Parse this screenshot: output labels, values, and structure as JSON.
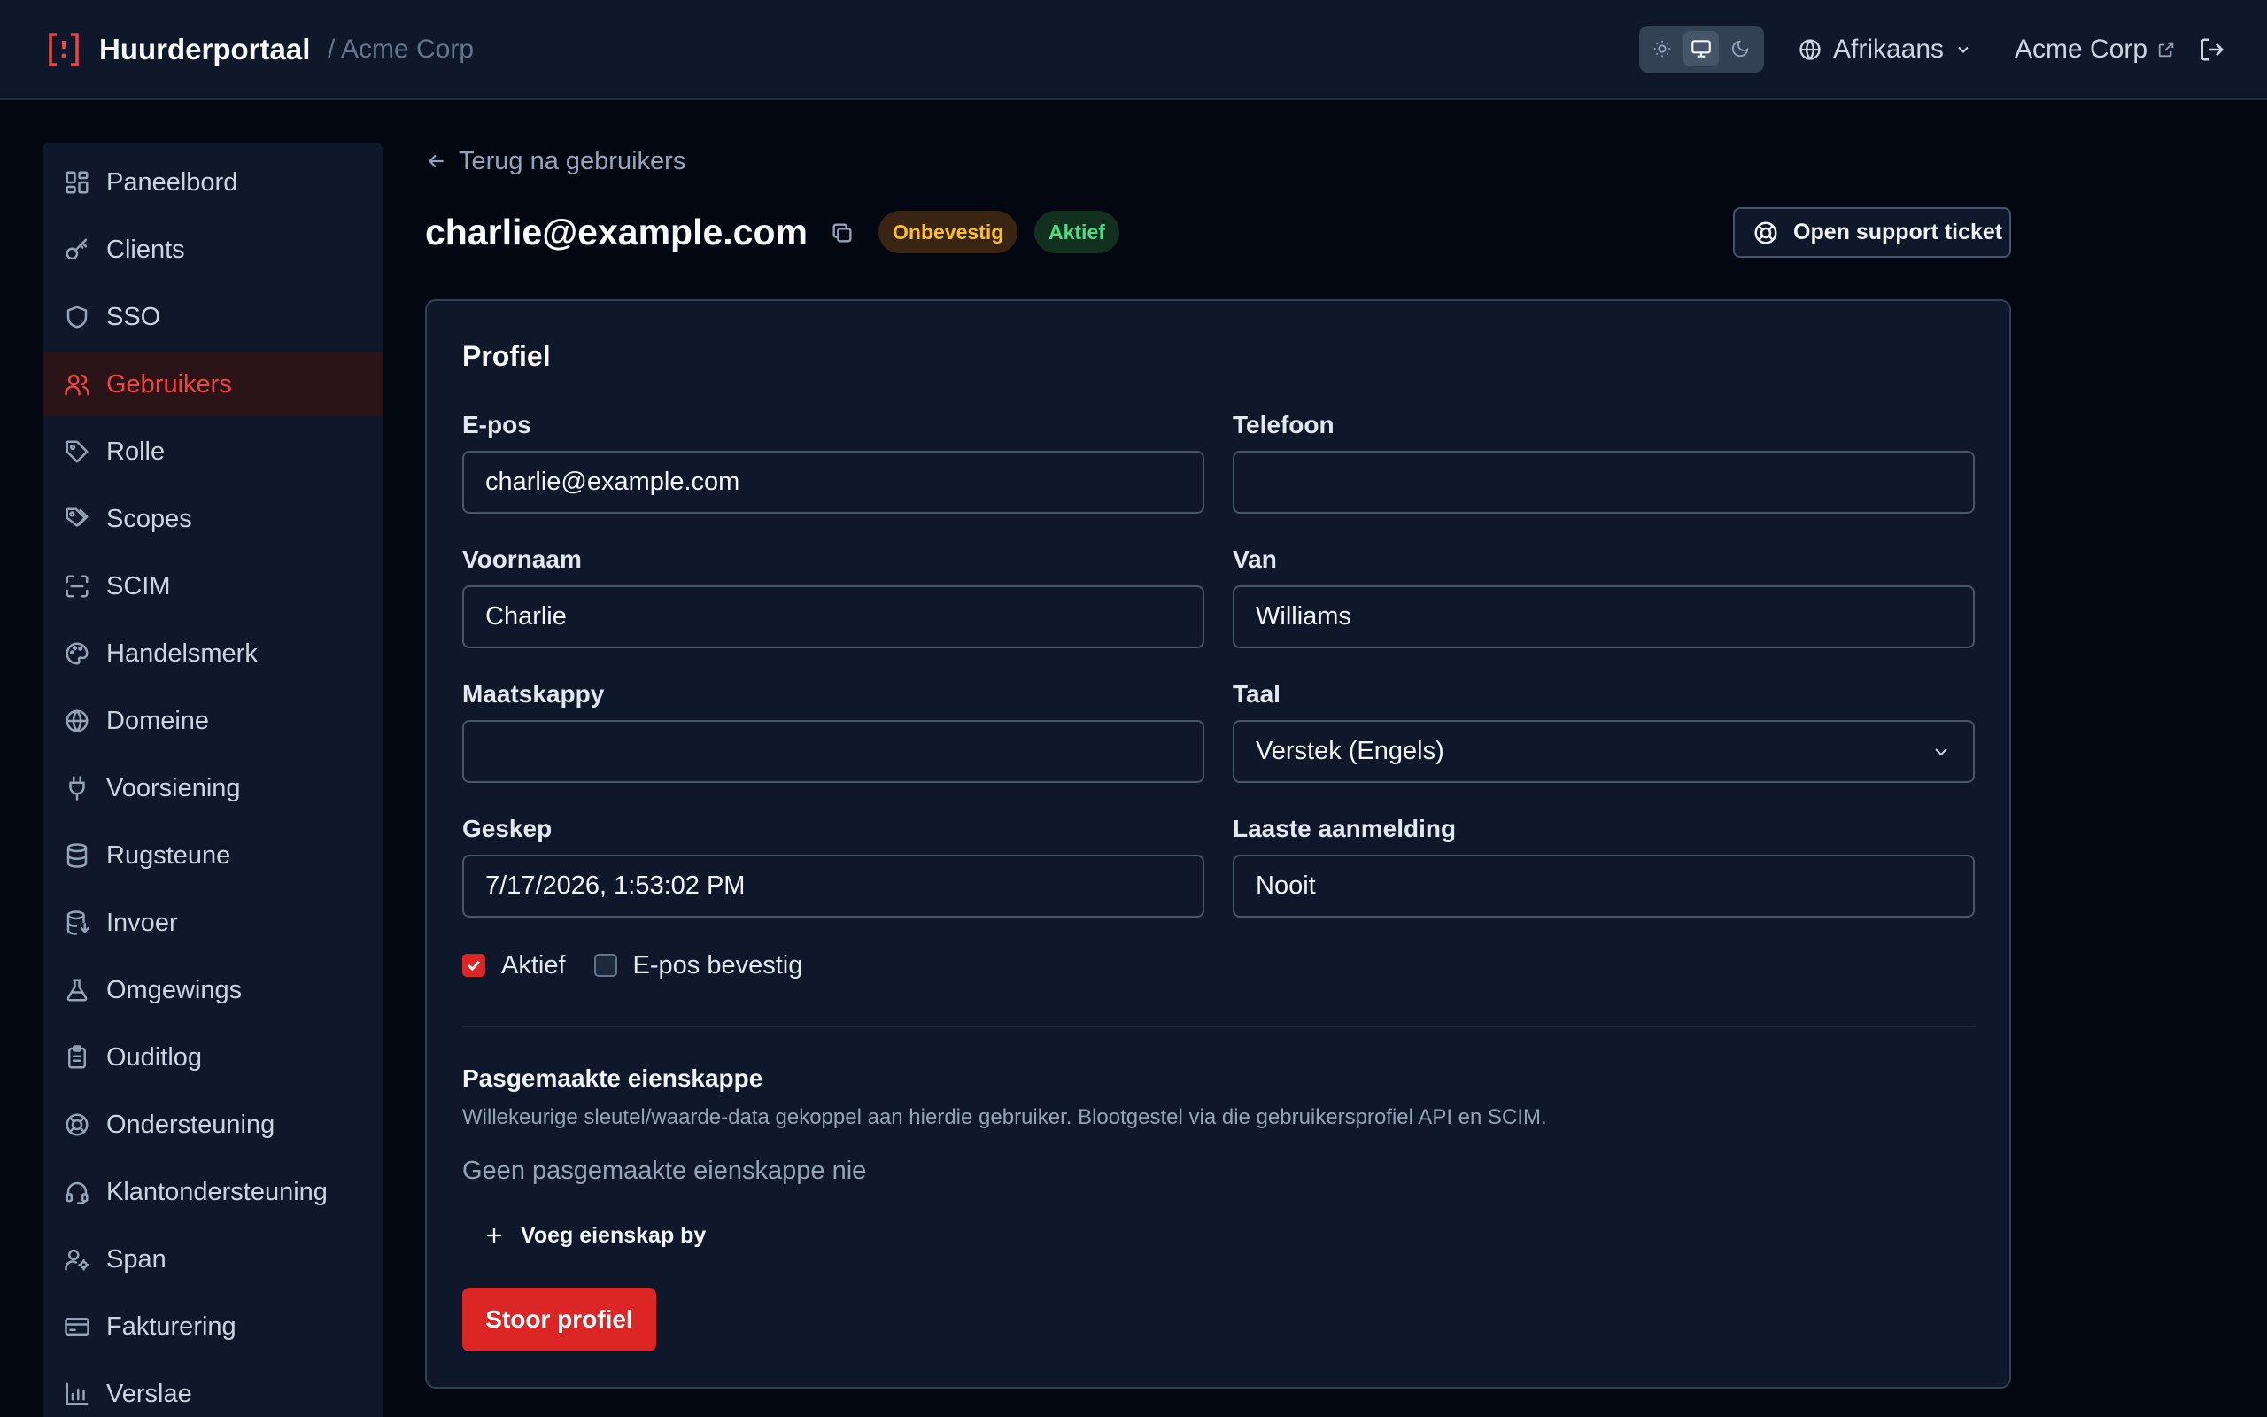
{
  "header": {
    "brand": "Huurderportaal",
    "tenant_crumb": "/ Acme Corp",
    "language": "Afrikaans",
    "tenant_link": "Acme Corp"
  },
  "sidebar": {
    "items": [
      {
        "label": "Paneelbord",
        "icon": "dashboard-icon"
      },
      {
        "label": "Clients",
        "icon": "key-icon"
      },
      {
        "label": "SSO",
        "icon": "shield-icon"
      },
      {
        "label": "Gebruikers",
        "icon": "users-icon",
        "active": true
      },
      {
        "label": "Rolle",
        "icon": "tag-icon"
      },
      {
        "label": "Scopes",
        "icon": "tags-icon"
      },
      {
        "label": "SCIM",
        "icon": "scan-icon"
      },
      {
        "label": "Handelsmerk",
        "icon": "palette-icon"
      },
      {
        "label": "Domeine",
        "icon": "globe-icon"
      },
      {
        "label": "Voorsiening",
        "icon": "plug-icon"
      },
      {
        "label": "Rugsteune",
        "icon": "database-icon"
      },
      {
        "label": "Invoer",
        "icon": "database-import-icon"
      },
      {
        "label": "Omgewings",
        "icon": "flask-icon"
      },
      {
        "label": "Ouditlog",
        "icon": "clipboard-icon"
      },
      {
        "label": "Ondersteuning",
        "icon": "lifebuoy-icon"
      },
      {
        "label": "Klantondersteuning",
        "icon": "headset-icon"
      },
      {
        "label": "Span",
        "icon": "user-cog-icon"
      },
      {
        "label": "Fakturering",
        "icon": "credit-card-icon"
      },
      {
        "label": "Verslae",
        "icon": "bar-chart-icon"
      }
    ]
  },
  "page": {
    "back_label": "Terug na gebruikers",
    "title": "charlie@example.com",
    "badge_unverified": "Onbevestig",
    "badge_active": "Aktief",
    "support_label": "Open support ticket"
  },
  "profile": {
    "title": "Profiel",
    "email_label": "E-pos",
    "email_value": "charlie@example.com",
    "phone_label": "Telefoon",
    "phone_value": "",
    "first_name_label": "Voornaam",
    "first_name_value": "Charlie",
    "last_name_label": "Van",
    "last_name_value": "Williams",
    "company_label": "Maatskappy",
    "company_value": "",
    "language_label": "Taal",
    "language_value": "Verstek (Engels)",
    "created_label": "Geskep",
    "created_value": "7/17/2026, 1:53:02 PM",
    "last_login_label": "Laaste aanmelding",
    "last_login_value": "Nooit",
    "active_label": "Aktief",
    "active_checked": true,
    "email_verified_label": "E-pos bevestig",
    "email_verified_checked": false
  },
  "custom_props": {
    "title": "Pasgemaakte eienskappe",
    "description": "Willekeurige sleutel/waarde-data gekoppel aan hierdie gebruiker. Blootgestel via die gebruikersprofiel API en SCIM.",
    "empty": "Geen pasgemaakte eienskappe nie",
    "add_label": "Voeg eienskap by"
  },
  "save_label": "Stoor profiel",
  "colors": {
    "accent": "#dc2626",
    "badge_warning": "#fbbf24",
    "badge_success": "#4ade80",
    "background": "#030712",
    "surface": "#0f172a"
  }
}
